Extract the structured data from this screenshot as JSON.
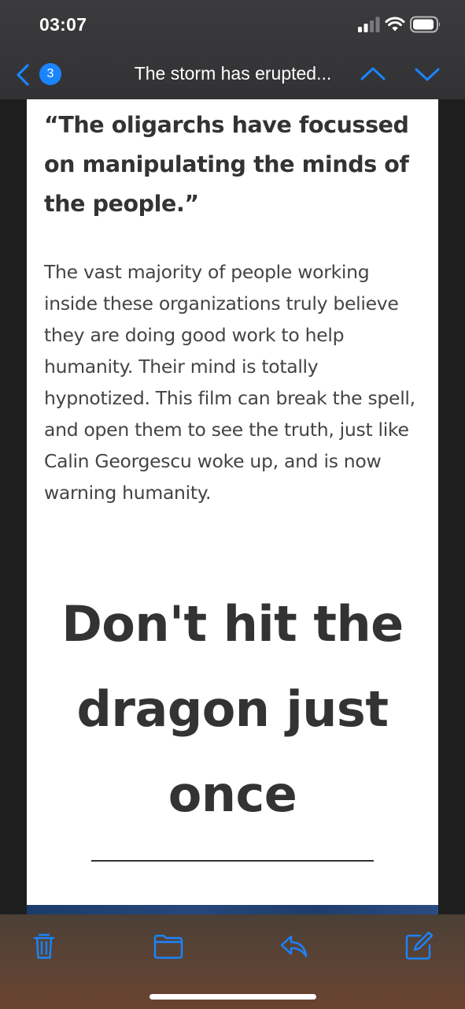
{
  "status_bar": {
    "time": "03:07",
    "icons": [
      "signal-icon",
      "wifi-icon",
      "battery-icon"
    ]
  },
  "nav_bar": {
    "back_icon": "chevron-left-icon",
    "unread_count": "3",
    "title": "The storm has erupted...",
    "prev_icon": "chevron-up-icon",
    "next_icon": "chevron-down-icon"
  },
  "article": {
    "quote_heading": "“The oligarchs have focussed on manipulating the minds of the people.”",
    "paragraph": "The vast majority of people working inside these organizations truly believe they are doing good work to help humanity. Their mind is totally hypnotized. This film can break the spell, and open them to see the truth, just like Calin Georgescu woke up, and is now warning humanity.",
    "big_heading": "Don't hit the dragon just once"
  },
  "toolbar": {
    "icons": [
      "trash-icon",
      "folder-icon",
      "reply-icon",
      "compose-icon"
    ]
  },
  "colors": {
    "accent": "#1a84ff",
    "heading_text": "#333333",
    "body_text": "#444444",
    "card_background": "#ffffff"
  }
}
